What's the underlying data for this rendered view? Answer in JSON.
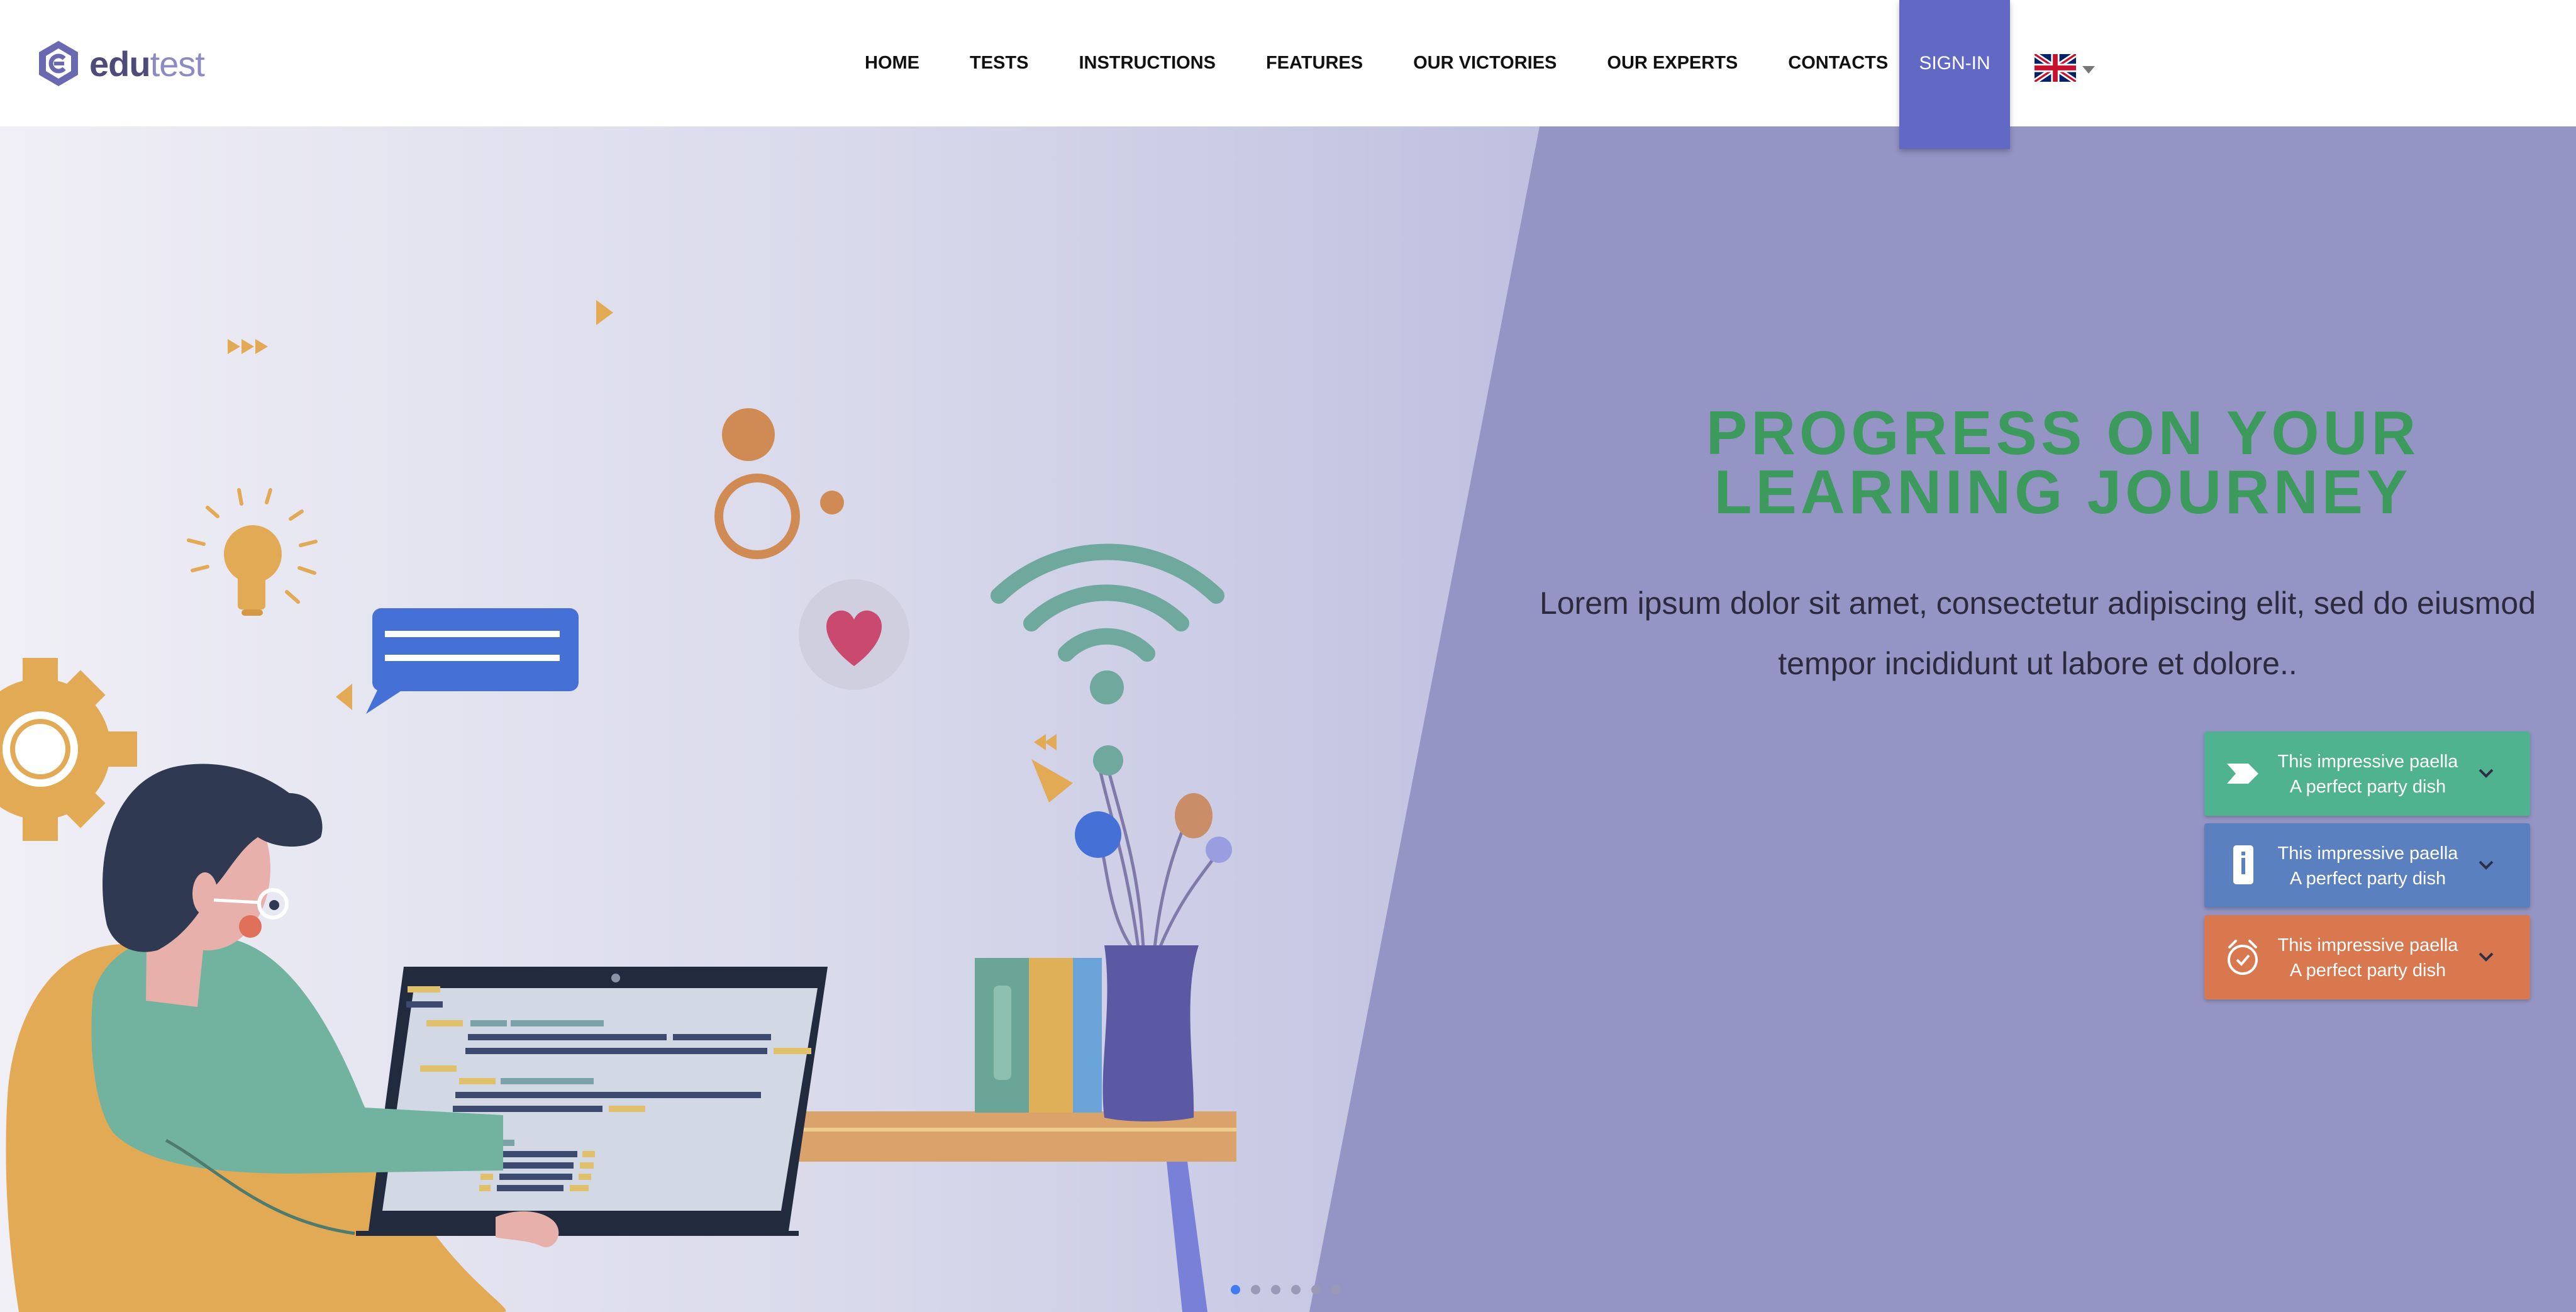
{
  "logo": {
    "text_bold": "edu",
    "text_light": "test",
    "icon": "edutest-hexagon-logo"
  },
  "nav": {
    "items": [
      {
        "label": "HOME"
      },
      {
        "label": "TESTS"
      },
      {
        "label": "INSTRUCTIONS"
      },
      {
        "label": "FEATURES"
      },
      {
        "label": "OUR VICTORIES"
      },
      {
        "label": "OUR EXPERTS"
      },
      {
        "label": "CONTACTS"
      }
    ],
    "signin_label": "SIGN-IN",
    "language": {
      "icon": "uk-flag-icon",
      "dropdown_icon": "caret-down-icon"
    }
  },
  "hero": {
    "title_line1": "PROGRESS ON YOUR",
    "title_line2": "LEARNING JOURNEY",
    "text_line1": "Lorem ipsum dolor sit amet, consectetur adipiscing elit, sed do eiusmod",
    "text_line2": "tempor incididunt ut labore et dolore..",
    "illustration": "person-coding-at-laptop-illustration",
    "cards": [
      {
        "line1": "This impressive paella",
        "line2": "A perfect party dish",
        "color": "#4fb38f",
        "icon": "tag-arrow-icon"
      },
      {
        "line1": "This impressive paella",
        "line2": "A perfect party dish",
        "color": "#5b80c0",
        "icon": "phone-info-icon"
      },
      {
        "line1": "This impressive paella",
        "line2": "A perfect party dish",
        "color": "#d9774f",
        "icon": "alarm-clock-icon"
      }
    ],
    "slider": {
      "total": 6,
      "active": 1
    }
  },
  "colors": {
    "accent": "#6169c4",
    "title_green": "#3c9a5c",
    "panel": "#9495c4"
  }
}
